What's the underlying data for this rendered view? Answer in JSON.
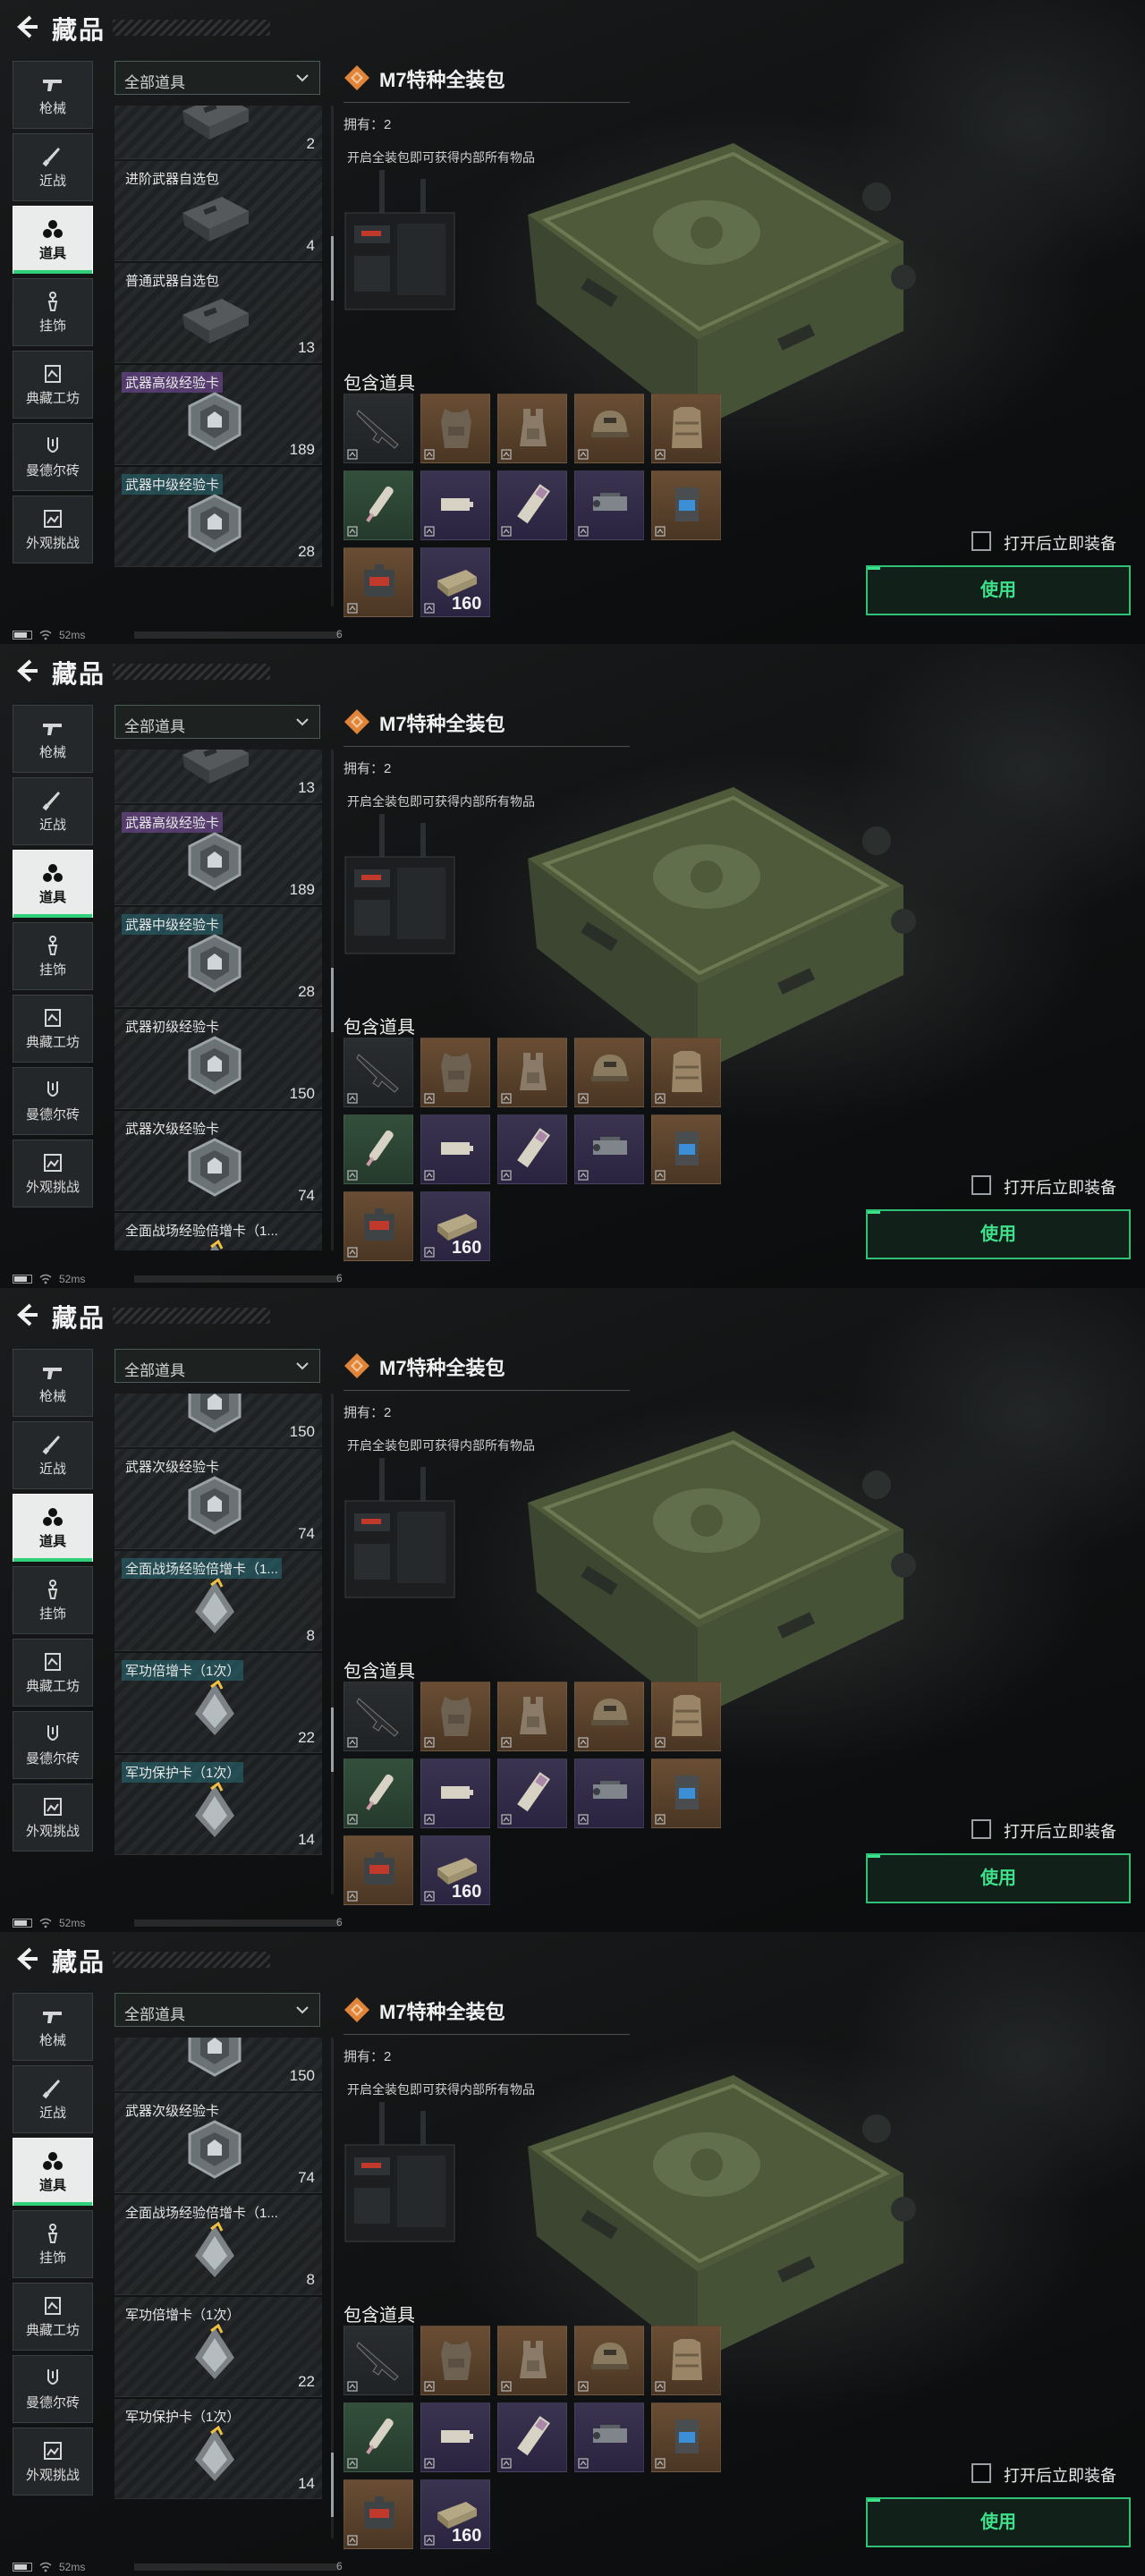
{
  "header": {
    "title": "藏品"
  },
  "categories": [
    {
      "label": "枪械",
      "icon": "gun-icon"
    },
    {
      "label": "近战",
      "icon": "knife-icon"
    },
    {
      "label": "道具",
      "icon": "items-icon",
      "active": true
    },
    {
      "label": "挂饰",
      "icon": "charm-icon"
    },
    {
      "label": "典藏工坊",
      "icon": "workshop-icon"
    },
    {
      "label": "曼德尔砖",
      "icon": "mandel-brick-icon"
    },
    {
      "label": "外观挑战",
      "icon": "appearance-challenge-icon"
    }
  ],
  "filter": {
    "label": "全部道具"
  },
  "screens": [
    {
      "items": [
        {
          "name": "",
          "qty": "2",
          "icon": "case-icon",
          "tag": ""
        },
        {
          "name": "进阶武器自选包",
          "qty": "4",
          "icon": "case-icon",
          "tag": ""
        },
        {
          "name": "普通武器自选包",
          "qty": "13",
          "icon": "case-icon",
          "tag": ""
        },
        {
          "name": "武器高级经验卡",
          "qty": "189",
          "icon": "exp-card-icon",
          "tag": "purple"
        },
        {
          "name": "武器中级经验卡",
          "qty": "28",
          "icon": "exp-card-icon",
          "tag": "teal"
        }
      ]
    },
    {
      "items": [
        {
          "name": "",
          "qty": "13",
          "icon": "case-icon",
          "tag": ""
        },
        {
          "name": "武器高级经验卡",
          "qty": "189",
          "icon": "exp-card-icon",
          "tag": "purple"
        },
        {
          "name": "武器中级经验卡",
          "qty": "28",
          "icon": "exp-card-icon",
          "tag": "teal"
        },
        {
          "name": "武器初级经验卡",
          "qty": "150",
          "icon": "exp-card-icon",
          "tag": ""
        },
        {
          "name": "武器次级经验卡",
          "qty": "74",
          "icon": "exp-card-icon",
          "tag": ""
        },
        {
          "name": "全面战场经验倍增卡（1...",
          "qty": "",
          "icon": "boost-card-icon",
          "tag": ""
        }
      ]
    },
    {
      "items": [
        {
          "name": "",
          "qty": "150",
          "icon": "exp-card-icon",
          "tag": ""
        },
        {
          "name": "武器次级经验卡",
          "qty": "74",
          "icon": "exp-card-icon",
          "tag": ""
        },
        {
          "name": "全面战场经验倍增卡（1...",
          "qty": "8",
          "icon": "boost-card-icon",
          "tag": "teal"
        },
        {
          "name": "军功倍增卡（1次）",
          "qty": "22",
          "icon": "boost-card-icon",
          "tag": "teal"
        },
        {
          "name": "军功保护卡（1次）",
          "qty": "14",
          "icon": "boost-card-icon",
          "tag": "teal"
        }
      ]
    },
    {
      "items": [
        {
          "name": "",
          "qty": "150",
          "icon": "exp-card-icon",
          "tag": ""
        },
        {
          "name": "武器次级经验卡",
          "qty": "74",
          "icon": "exp-card-icon",
          "tag": ""
        },
        {
          "name": "全面战场经验倍增卡（1...",
          "qty": "8",
          "icon": "boost-card-icon",
          "tag": ""
        },
        {
          "name": "军功倍增卡（1次）",
          "qty": "22",
          "icon": "boost-card-icon",
          "tag": ""
        },
        {
          "name": "军功保护卡（1次）",
          "qty": "14",
          "icon": "boost-card-icon",
          "tag": ""
        }
      ]
    }
  ],
  "scroll_offsets": [
    0.3,
    0.5,
    0.72,
    0.95
  ],
  "detail": {
    "title": "M7特种全装包",
    "owned": "拥有：2",
    "description": "开启全装包即可获得内部所有物品",
    "contents_title": "包含道具",
    "contents": [
      {
        "icon": "rifle-icon",
        "quality": "dark",
        "qty": ""
      },
      {
        "icon": "armor-vest-icon",
        "quality": "brown",
        "qty": ""
      },
      {
        "icon": "backpack-icon",
        "quality": "brown",
        "qty": ""
      },
      {
        "icon": "helmet-icon",
        "quality": "brown",
        "qty": ""
      },
      {
        "icon": "chest-rig-icon",
        "quality": "brown",
        "qty": ""
      },
      {
        "icon": "syringe-icon",
        "quality": "green",
        "qty": ""
      },
      {
        "icon": "battery-icon",
        "quality": "purple",
        "qty": ""
      },
      {
        "icon": "bandage-icon",
        "quality": "purple",
        "qty": ""
      },
      {
        "icon": "scope-icon",
        "quality": "purple",
        "qty": ""
      },
      {
        "icon": "device-icon",
        "quality": "brown",
        "qty": ""
      },
      {
        "icon": "medkit-icon",
        "quality": "brown",
        "qty": ""
      },
      {
        "icon": "ammo-box-icon",
        "quality": "purple",
        "qty": "160"
      }
    ]
  },
  "actions": {
    "equip_label": "打开后立即装备",
    "use_label": "使用"
  },
  "status": {
    "latency": "52ms",
    "extra": "6"
  },
  "colors": {
    "accent": "#2fc277",
    "active_underline": "#2fd07a"
  }
}
